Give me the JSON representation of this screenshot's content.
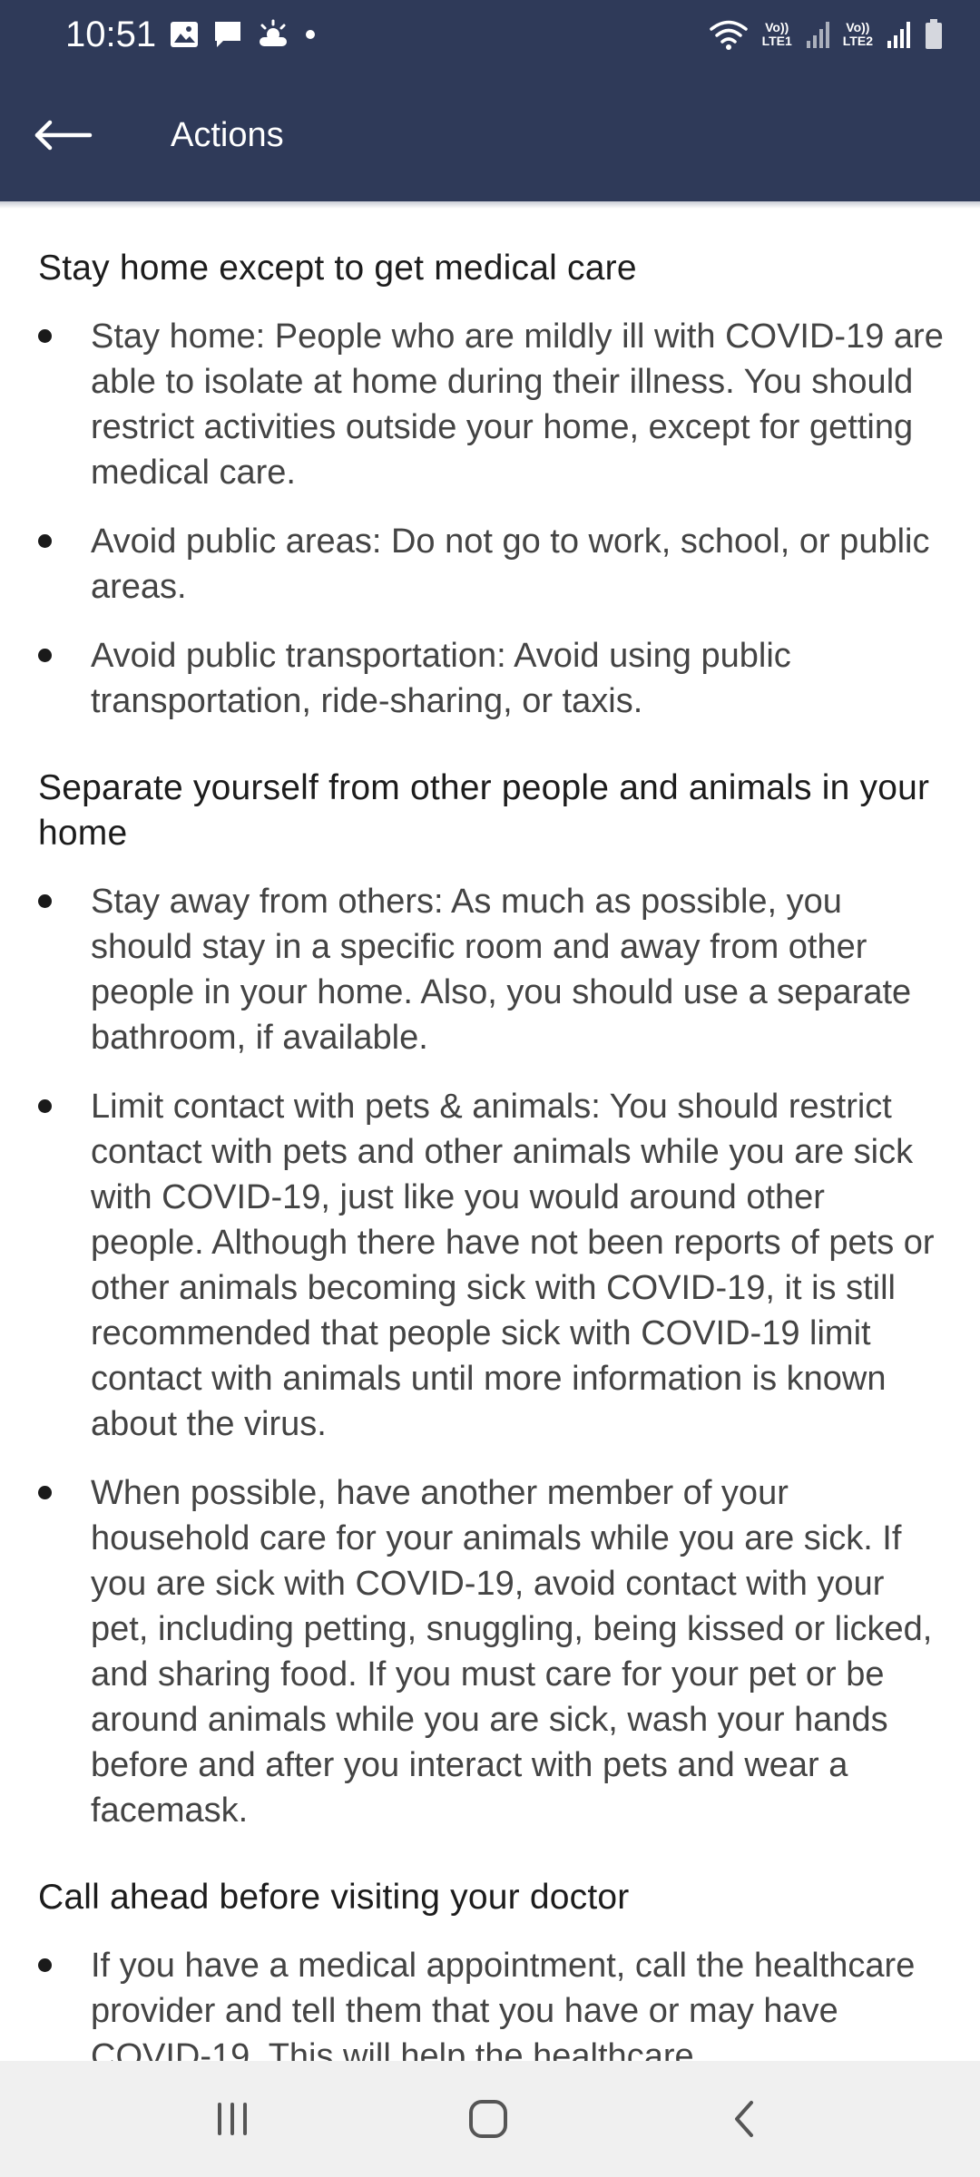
{
  "status_bar": {
    "time": "10:51",
    "left_icons": [
      "image-icon",
      "chat-icon",
      "weather-icon",
      "dot-icon"
    ],
    "right_icons": [
      "wifi-icon",
      "volte-lte1-icon",
      "signal-icon",
      "volte-lte2-icon",
      "signal-icon",
      "battery-icon"
    ],
    "volte_label": "Vo))",
    "lte1_label": "LTE1",
    "lte2_label": "LTE2"
  },
  "app_bar": {
    "title": "Actions",
    "back_icon": "arrow-left-icon"
  },
  "sections": [
    {
      "heading": "Stay home except to get medical care",
      "items": [
        "Stay home: People who are mildly ill with COVID-19 are able to isolate at home during their illness. You should restrict activities outside your home, except for getting medical care.",
        "Avoid public areas: Do not go to work, school, or public areas.",
        "Avoid public transportation: Avoid using public transportation, ride-sharing, or taxis."
      ]
    },
    {
      "heading": "Separate yourself from other people and animals in your home",
      "items": [
        "Stay away from others: As much as possible, you should stay in a specific room and away from other people in your home. Also, you should use a separate bathroom, if available.",
        "Limit contact with pets & animals: You should restrict contact with pets and other animals while you are sick with COVID-19, just like you would around other people. Although there have not been reports of pets or other animals becoming sick with COVID-19, it is still recommended that people sick with COVID-19 limit contact with animals until more information is known about the virus.",
        "When possible, have another member of your household care for your animals while you are sick. If you are sick with COVID-19, avoid contact with your pet, including petting, snuggling, being kissed or licked, and sharing food. If you must care for your pet or be around animals while you are sick, wash your hands before and after you interact with pets and wear a facemask."
      ]
    },
    {
      "heading": "Call ahead before visiting your doctor",
      "items": [
        "If you have a medical appointment, call the healthcare provider and tell them that you have or may have COVID-19. This will help the healthcare"
      ]
    }
  ],
  "nav_bar": {
    "recents_icon": "recents-icon",
    "home_icon": "home-icon",
    "back_icon": "back-chevron-icon"
  },
  "colors": {
    "header_bg": "#2f3a59",
    "text": "#444444",
    "heading": "#1c1c1c",
    "nav_bg": "#f0f0f0"
  }
}
